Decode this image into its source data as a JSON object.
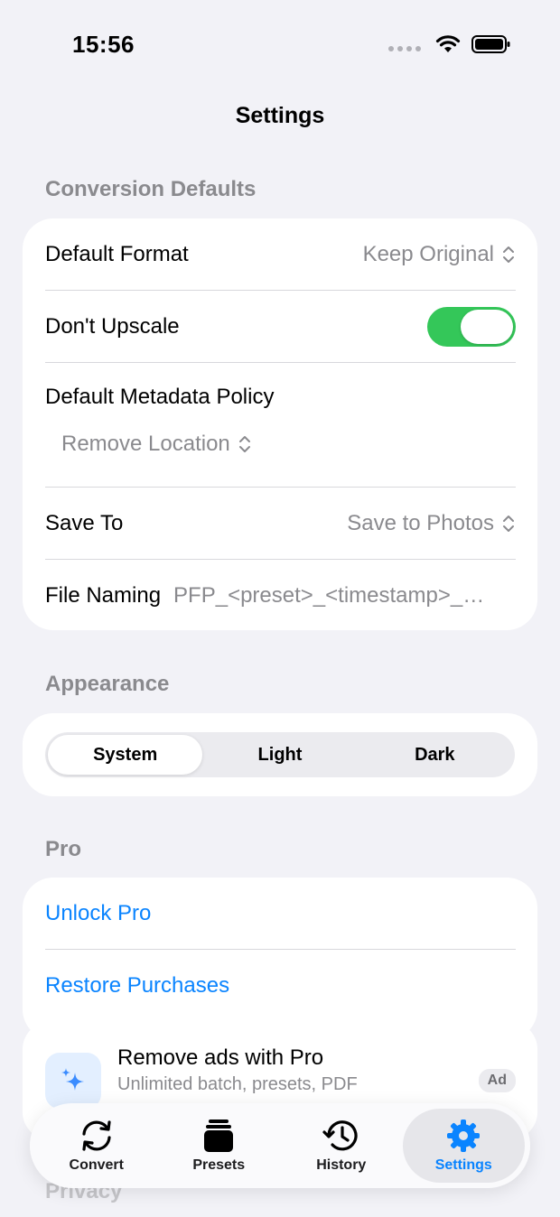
{
  "status_bar": {
    "time": "15:56"
  },
  "nav": {
    "title": "Settings"
  },
  "conversion_defaults": {
    "header": "Conversion Defaults",
    "default_format": {
      "label": "Default Format",
      "value": "Keep Original"
    },
    "dont_upscale": {
      "label": "Don't Upscale",
      "enabled": true
    },
    "metadata_policy": {
      "label": "Default Metadata Policy",
      "value": "Remove Location"
    },
    "save_to": {
      "label": "Save To",
      "value": "Save to Photos"
    },
    "file_naming": {
      "label": "File Naming",
      "value": "PFP_<preset>_<timestamp>_…"
    }
  },
  "appearance": {
    "header": "Appearance",
    "options": [
      "System",
      "Light",
      "Dark"
    ],
    "selected": "System"
  },
  "pro": {
    "header": "Pro",
    "unlock_label": "Unlock Pro",
    "restore_label": "Restore Purchases"
  },
  "ad": {
    "title": "Remove ads with Pro",
    "subtitle": "Unlimited batch, presets, PDF",
    "badge": "Ad"
  },
  "privacy": {
    "header": "Privacy"
  },
  "tab_bar": {
    "tabs": [
      {
        "label": "Convert",
        "icon": "convert-icon"
      },
      {
        "label": "Presets",
        "icon": "presets-icon"
      },
      {
        "label": "History",
        "icon": "history-icon"
      },
      {
        "label": "Settings",
        "icon": "gear-icon"
      }
    ],
    "active": "Settings"
  },
  "colors": {
    "accent": "#0a84ff",
    "toggle_on": "#34c759",
    "background": "#f2f2f7"
  }
}
